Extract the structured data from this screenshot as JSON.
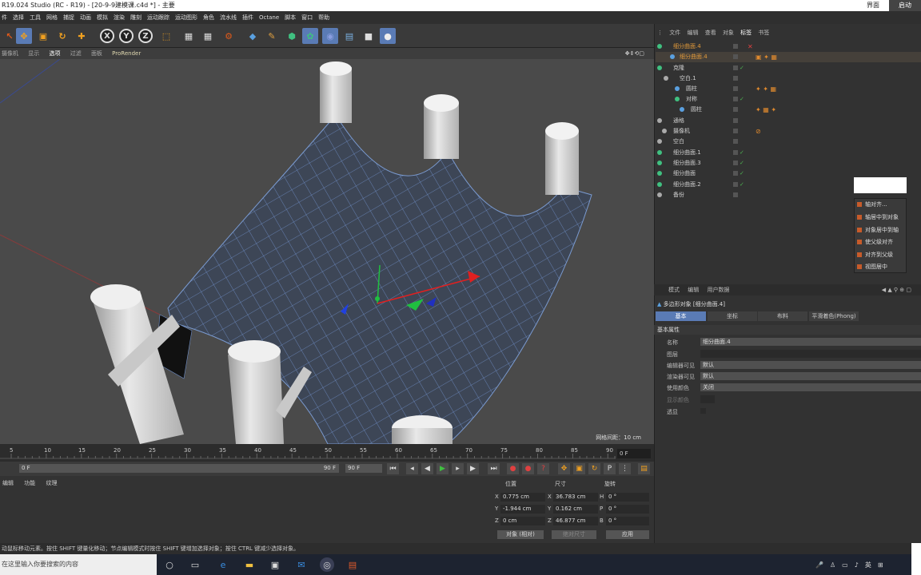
{
  "window": {
    "title": "R19.024 Studio (RC - R19) - [20-9-9建模课.c4d *] - 主要",
    "controls": [
      "界面",
      "启动"
    ]
  },
  "menubar": {
    "items": [
      "件",
      "选择",
      "工具",
      "网格",
      "捕捉",
      "动画",
      "模拟",
      "渲染",
      "雕刻",
      "运动跟踪",
      "运动图形",
      "角色",
      "流水线",
      "插件",
      "Octane",
      "脚本",
      "窗口",
      "帮助"
    ]
  },
  "viewport_menu": {
    "items": [
      "摄像机",
      "显示",
      "选项",
      "过滤",
      "面板"
    ],
    "selected": "选项",
    "renderer": "ProRender"
  },
  "viewport": {
    "grid_info": "网格间距：10 cm"
  },
  "timeline": {
    "ticks": [
      "5",
      "10",
      "15",
      "20",
      "25",
      "30",
      "35",
      "40",
      "45",
      "50",
      "55",
      "60",
      "65",
      "70",
      "75",
      "80",
      "85",
      "90"
    ],
    "current_frame": "0 F"
  },
  "transport": {
    "start": "0 F",
    "end_field": "90 F",
    "end": "90 F"
  },
  "bottom_panel": {
    "menu": [
      "编辑",
      "功能",
      "纹理"
    ]
  },
  "coords": {
    "headers": [
      "位置",
      "尺寸",
      "旋转"
    ],
    "rows": [
      {
        "axis": "X",
        "pos": "0.775 cm",
        "size": "36.783 cm",
        "rot_axis": "H",
        "rot": "0 °"
      },
      {
        "axis": "Y",
        "pos": "-1.944 cm",
        "size": "0.162 cm",
        "rot_axis": "P",
        "rot": "0 °"
      },
      {
        "axis": "Z",
        "pos": "0 cm",
        "size": "46.877 cm",
        "rot_axis": "B",
        "rot": "0 °"
      }
    ],
    "mode": "对象 (相对)",
    "size_mode": "绝对尺寸",
    "apply": "应用"
  },
  "statusbar": {
    "text": "动鼠标移动元素。按住 SHIFT 键量化移动；节点编辑模式时按住 SHIFT 键增加选择对象；按住 CTRL 键减少选择对象。"
  },
  "taskbar": {
    "search": "在这里输入你要搜索的内容",
    "tray_lang": "英"
  },
  "object_manager": {
    "menu": [
      "文件",
      "编辑",
      "查看",
      "对象",
      "标签",
      "书签"
    ],
    "selected": "标签",
    "objects": [
      {
        "name": "细分曲面.4",
        "selected": true
      },
      {
        "name": "细分曲面.4",
        "selected": true
      },
      {
        "name": "克隆",
        "selected": false
      },
      {
        "name": "空白.1",
        "selected": false
      },
      {
        "name": "圆柱",
        "selected": false
      },
      {
        "name": "对称",
        "selected": false
      },
      {
        "name": "圆柱",
        "selected": false
      },
      {
        "name": "通格",
        "selected": false
      },
      {
        "name": "摄像机",
        "selected": false
      },
      {
        "name": "空白",
        "selected": false
      },
      {
        "name": "细分曲面.1",
        "selected": false
      },
      {
        "name": "细分曲面.3",
        "selected": false
      },
      {
        "name": "细分曲面",
        "selected": false
      },
      {
        "name": "细分曲面.2",
        "selected": false
      },
      {
        "name": "备份",
        "selected": false
      }
    ]
  },
  "context_menu": {
    "items": [
      "轴对齐...",
      "轴居中到对象",
      "对象居中到轴",
      "使父级对齐",
      "对齐到父级",
      "视图居中"
    ]
  },
  "attributes": {
    "menu": [
      "模式",
      "编辑",
      "用户数据"
    ],
    "title": "多边形对象 [细分曲面.4]",
    "tabs": [
      "基本",
      "坐标",
      "布料",
      "平滑着色(Phong)"
    ],
    "selected_tab": "基本",
    "section": "基本属性",
    "fields": [
      {
        "label": "名称",
        "value": "细分曲面.4"
      },
      {
        "label": "图层",
        "value": ""
      },
      {
        "label": "编辑器可见",
        "value": "默认"
      },
      {
        "label": "渲染器可见",
        "value": "默认"
      },
      {
        "label": "使用颜色",
        "value": "关闭"
      },
      {
        "label": "显示颜色",
        "value": ""
      },
      {
        "label": "透显",
        "value": ""
      }
    ]
  }
}
